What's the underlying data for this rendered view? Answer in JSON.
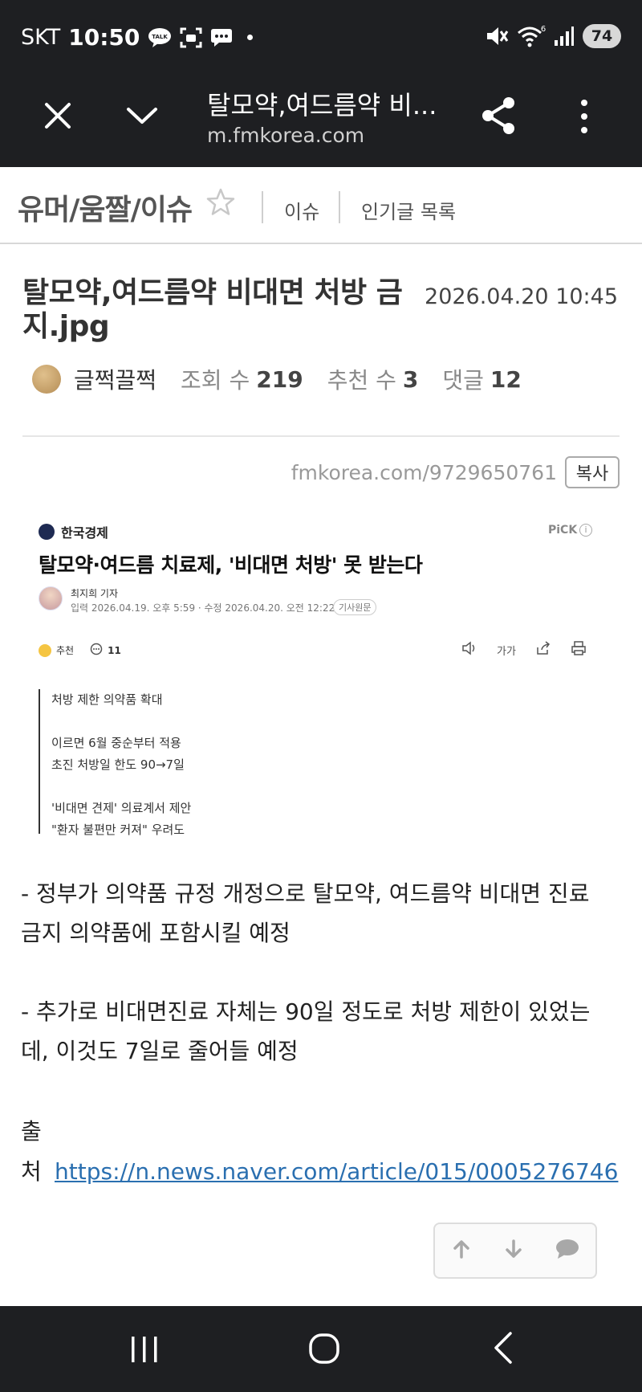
{
  "status_bar": {
    "carrier": "SKT",
    "time": "10:50",
    "battery": "74",
    "wifi_badge": "6"
  },
  "browser": {
    "title": "탈모약,여드름약 비...",
    "url": "m.fmkorea.com"
  },
  "board": {
    "name": "유머/움짤/이슈",
    "links": [
      "이슈",
      "인기글 목록"
    ]
  },
  "post": {
    "title": "탈모약,여드름약 비대면 처방 금지.jpg",
    "date": "2026.04.20 10:45",
    "author": "글쩍끌쩍",
    "views_label": "조회 수",
    "views": "219",
    "likes_label": "추천 수",
    "likes": "3",
    "comments_label": "댓글",
    "comments": "12",
    "short_url": "fmkorea.com/9729650761",
    "copy_label": "복사"
  },
  "news_image": {
    "publisher": "한국경제",
    "pick": "PiCK",
    "headline": "탈모약·여드름 치료제, '비대면 처방' 못 받는다",
    "reporter": "최지희 기자",
    "dates": "입력 2026.04.19. 오후 5:59 · 수정 2026.04.20. 오전 12:22",
    "original_label": "기사원문",
    "recommend_label": "추천",
    "comment_count": "11",
    "font_label": "가가",
    "summary": [
      "처방 제한 의약품 확대",
      "이르면 6월 중순부터 적용",
      "초진 처방일 한도 90→7일",
      "'비대면 견제' 의료계서 제안",
      "\"환자 불편만 커져\" 우려도"
    ]
  },
  "body": {
    "para1_line1": "- 정부가 의약품 규정 개정으로 탈모약, 여드름약 비대면 진료",
    "para1_line2": "금지 의약품에 포함시킬 예정",
    "para2_line1": "- 추가로 비대면진료 자체는 90일 정도로 처방 제한이 있었는",
    "para2_line2": "데, 이것도 7일로 줄어들 예정",
    "source_char1": "출",
    "source_char2": "처",
    "source_url": "https://n.news.naver.com/article/015/0005276746"
  }
}
